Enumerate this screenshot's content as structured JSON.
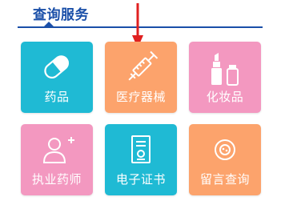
{
  "header": {
    "title": "查询服务"
  },
  "tiles": [
    {
      "label": "药品",
      "icon": "pill-icon",
      "color": "#1fbad4"
    },
    {
      "label": "医疗器械",
      "icon": "syringe-icon",
      "color": "#fca36c"
    },
    {
      "label": "化妆品",
      "icon": "cosmetics-icon",
      "color": "#f398c0"
    },
    {
      "label": "执业药师",
      "icon": "add-user-icon",
      "color": "#f398c0"
    },
    {
      "label": "电子证书",
      "icon": "certificate-icon",
      "color": "#1fbad4"
    },
    {
      "label": "留言查询",
      "icon": "message-icon",
      "color": "#fca36c"
    }
  ],
  "colors": {
    "accent": "#1a4fa8",
    "annotation_arrow": "#e02020"
  }
}
